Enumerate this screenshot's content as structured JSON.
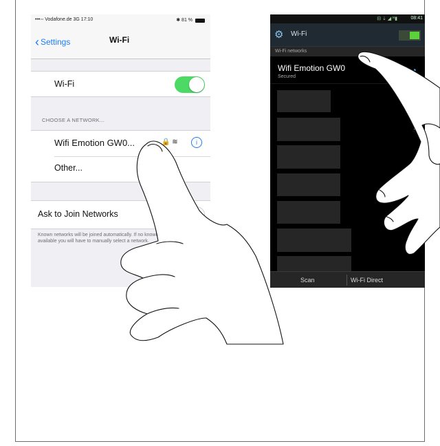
{
  "ios": {
    "status": {
      "carrier": "•••◦◦ Vodafone.de 3G 17:10",
      "battery": "✱ 81 %"
    },
    "nav": {
      "back_label": "Settings",
      "title": "Wi-Fi"
    },
    "wifi_row": {
      "label": "Wi-Fi",
      "toggle_on": true
    },
    "section_header": "CHOOSE A NETWORK...",
    "networks": [
      {
        "name": "Wifi Emotion GW0...",
        "icons": "🔒 ≋"
      },
      {
        "name": "Other..."
      }
    ],
    "ask_row": {
      "label": "Ask to Join Networks",
      "toggle_on": false
    },
    "footer": "Known networks will be joined automatically. If no known networks are available you will have to manually select a network."
  },
  "android": {
    "status": {
      "time": "08:41",
      "icons": "⊟ ⇣ ◢ ᴴ▮"
    },
    "title": "Wi-Fi",
    "subheader": "Wi-Fi networks",
    "network": {
      "name": "Wifi Emotion GW0",
      "security": "Secured"
    },
    "buttons": {
      "scan": "Scan",
      "direct": "Wi-Fi Direct"
    }
  },
  "colors": {
    "ios_blue": "#1a7cf5",
    "ios_green": "#4cd964",
    "android_accent": "#4ab3e8"
  },
  "icons": [
    "chevron-left-icon",
    "lock-icon",
    "wifi-icon",
    "info-icon",
    "gear-icon",
    "hand-pointer-icon"
  ]
}
